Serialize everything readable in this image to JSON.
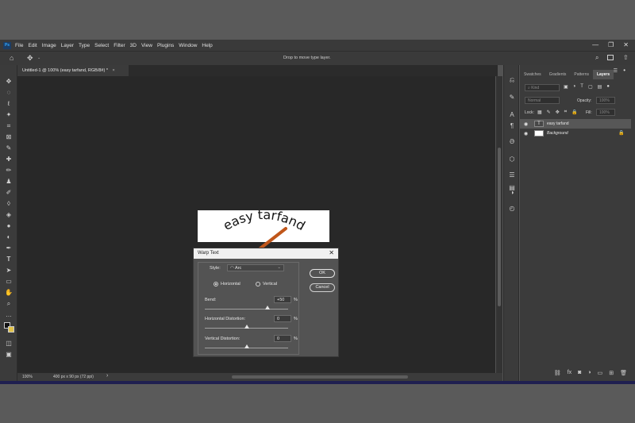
{
  "app": {
    "logo": "Ps"
  },
  "menubar": {
    "items": [
      "File",
      "Edit",
      "Image",
      "Layer",
      "Type",
      "Select",
      "Filter",
      "3D",
      "View",
      "Plugins",
      "Window",
      "Help"
    ],
    "window_controls": [
      "—",
      "❐",
      "✕"
    ]
  },
  "options_bar": {
    "hint": "Drop to move type layer."
  },
  "document": {
    "tab_title": "Untitled-1 @ 100% (easy tarfand, RGB/8#) *"
  },
  "status_bar": {
    "zoom": "100%",
    "doc_info": "400 px x 90 px (72 ppi)"
  },
  "canvas": {
    "preview_text": "easy tarfand"
  },
  "panel": {
    "tabs": [
      "Swatches",
      "Gradients",
      "Patterns",
      "Layers"
    ],
    "active_tab": "Layers",
    "kind_placeholder": "Kind",
    "blend_mode": "Normal",
    "opacity_label": "Opacity:",
    "opacity_value": "100%",
    "lock_label": "Lock:",
    "fill_label": "Fill:",
    "fill_value": "100%",
    "layers": [
      {
        "name": "easy tarfand",
        "type": "text"
      },
      {
        "name": "Background",
        "type": "background"
      }
    ]
  },
  "dialog": {
    "title": "Warp Text",
    "close": "✕",
    "style_label": "Style:",
    "style_value": "Arc",
    "orientation_options": [
      "Horizontal",
      "Vertical"
    ],
    "orientation_selected": "Horizontal",
    "bend_label": "Bend:",
    "bend_value": "+50",
    "hdist_label": "Horizontal Distortion:",
    "hdist_value": "0",
    "vdist_label": "Vertical Distortion:",
    "vdist_value": "0",
    "percent": "%",
    "ok_label": "OK",
    "cancel_label": "Cancel",
    "slider_levels": {
      "bend": 50,
      "horizontal_distortion": 0,
      "vertical_distortion": 0
    }
  },
  "colors": {
    "arrow": "#c0561a",
    "accent_text": "#31a8ff"
  }
}
